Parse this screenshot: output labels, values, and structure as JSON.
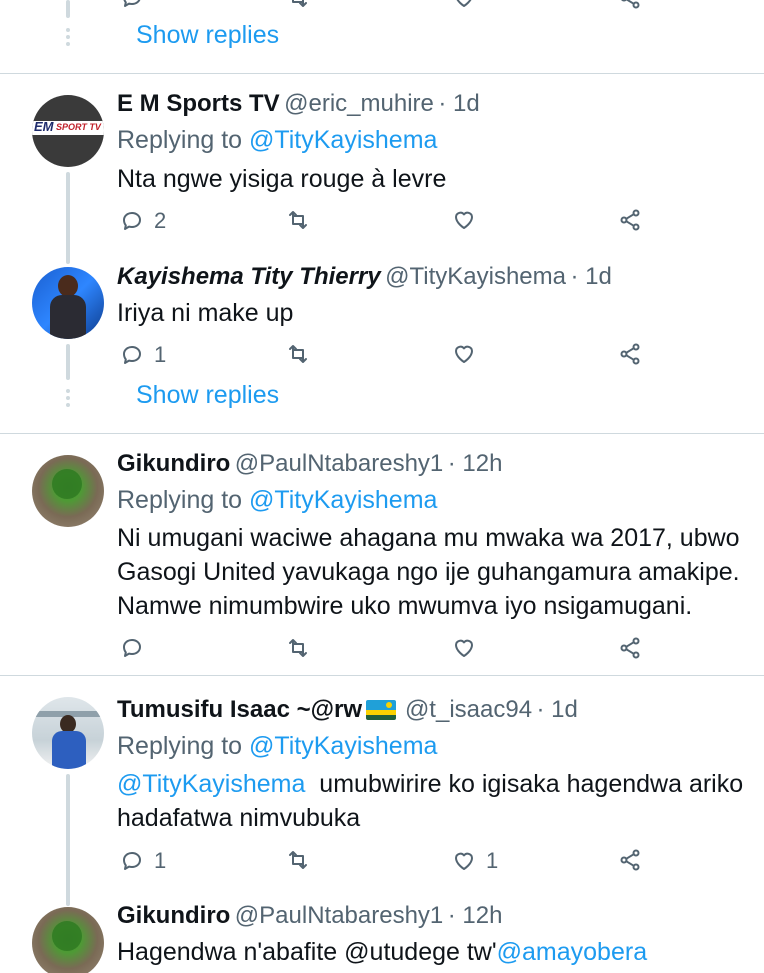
{
  "top": {
    "show_replies": "Show replies"
  },
  "tweets": [
    {
      "name": "E M Sports TV",
      "handle": "@eric_muhire",
      "time": "· 1d",
      "replying_label": "Replying to",
      "replying_to": "@TityKayishema",
      "text": "Nta ngwe yisiga rouge à levre",
      "reply_count": "2",
      "like_count": "",
      "avatar_text": "EM",
      "avatar_sub": "SPORT TV"
    },
    {
      "name": "Kayishema Tity Thierry",
      "handle": "@TityKayishema",
      "time": "· 1d",
      "text": "Iriya ni make up",
      "reply_count": "1",
      "like_count": "",
      "show_replies": "Show replies"
    },
    {
      "name": "Gikundiro",
      "handle": "@PaulNtabareshy1",
      "time": "· 12h",
      "replying_label": "Replying to",
      "replying_to": "@TityKayishema",
      "text_line1": "Ni umugani waciwe ahagana mu mwaka wa 2017, ubwo",
      "text_line2": "Gasogi United yavukaga ngo ije guhangamura amakipe.",
      "text_line3": "Namwe nimumbwire uko mwumva iyo nsigamugani.",
      "reply_count": "",
      "like_count": ""
    },
    {
      "name": "Tumusifu Isaac ~@rw",
      "handle": "@t_isaac94",
      "time": "· 1d",
      "replying_label": "Replying to",
      "replying_to": "@TityKayishema",
      "mention": "@TityKayishema",
      "text_line1": " umubwirire ko igisaka hagendwa ariko",
      "text_line2": "hadafatwa nimvubuka",
      "reply_count": "1",
      "like_count": "1"
    },
    {
      "name": "Gikundiro",
      "handle": "@PaulNtabareshy1",
      "time": "· 12h",
      "text": "Hagendwa n'abafite @utudege tw'",
      "mention": "@amayobera"
    }
  ],
  "colors": {
    "link": "#1d9bf0",
    "muted": "#536471",
    "line": "#cfd9de"
  }
}
